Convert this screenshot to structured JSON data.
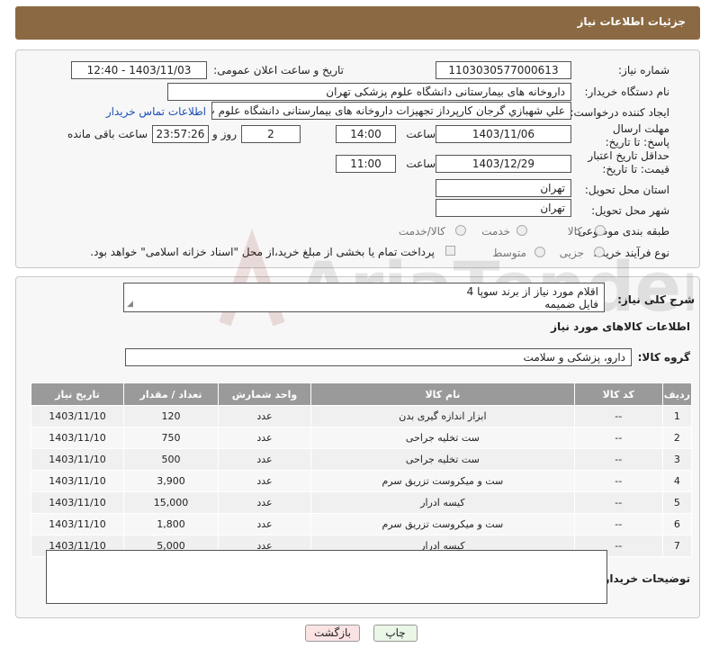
{
  "header": {
    "title": "جزئیات اطلاعات نیاز"
  },
  "form": {
    "need_number_label": "شماره نیاز:",
    "need_number": "1103030577000613",
    "announce_label": "تاریخ و ساعت اعلان عمومی:",
    "announce_value": "1403/11/03 - 12:40",
    "buyer_org_label": "نام دستگاه خریدار:",
    "buyer_org": "داروخانه های بیمارستانی دانشگاه علوم پزشکی تهران",
    "requester_label": "ایجاد کننده درخواست:",
    "requester": "علي شهبازي گرجان کارپرداز تجهیزات داروخانه های بیمارستانی دانشگاه علوم پ",
    "contact_link": "اطلاعات تماس خریدار",
    "reply_deadline_label": "مهلت ارسال پاسخ: تا تاریخ:",
    "reply_date": "1403/11/06",
    "time_label": "ساعت",
    "reply_time": "14:00",
    "days_value": "2",
    "days_label": "روز و",
    "remaining_value": "23:57:26",
    "remaining_label": "ساعت باقی مانده",
    "price_validity_label": "حداقل تاریخ اعتبار قیمت: تا تاریخ:",
    "validity_date": "1403/12/29",
    "validity_time": "11:00",
    "province_label": "استان محل تحویل:",
    "province": "تهران",
    "city_label": "شهر محل تحویل:",
    "city": "تهران",
    "category_label": "طبقه بندی موضوعی:",
    "category_options": [
      "کالا",
      "خدمت",
      "کالا/خدمت"
    ],
    "purchase_type_label": "نوع فرآیند خرید :",
    "purchase_options": [
      "جزیی",
      "متوسط"
    ],
    "payment_note": "پرداخت تمام یا بخشی از مبلغ خرید،از محل \"اسناد خزانه اسلامی\" خواهد بود."
  },
  "description": {
    "label": "شرح کلی نیاز:",
    "line1": "اقلام مورد نیاز از برند سوپا 4",
    "line2": "فایل ضمیمه"
  },
  "goods": {
    "section_title": "اطلاعات کالاهای مورد نیاز",
    "group_label": "گروه کالا:",
    "group_value": "دارو، پزشکی و سلامت"
  },
  "table": {
    "columns": [
      "ردیف",
      "کد کالا",
      "نام کالا",
      "واحد شمارش",
      "تعداد / مقدار",
      "تاریخ نیاز"
    ],
    "rows": [
      [
        "1",
        "--",
        "ابزار اندازه گیری بدن",
        "عدد",
        "120",
        "1403/11/10"
      ],
      [
        "2",
        "--",
        "ست تخلیه جراحی",
        "عدد",
        "750",
        "1403/11/10"
      ],
      [
        "3",
        "--",
        "ست تخلیه جراحی",
        "عدد",
        "500",
        "1403/11/10"
      ],
      [
        "4",
        "--",
        "ست و میکروست تزریق سرم",
        "عدد",
        "3,900",
        "1403/11/10"
      ],
      [
        "5",
        "--",
        "کیسه ادرار",
        "عدد",
        "15,000",
        "1403/11/10"
      ],
      [
        "6",
        "--",
        "ست و میکروست تزریق سرم",
        "عدد",
        "1,800",
        "1403/11/10"
      ],
      [
        "7",
        "--",
        "کیسه ادرار",
        "عدد",
        "5,000",
        "1403/11/10"
      ]
    ]
  },
  "buyer_notes": {
    "label": "توضیحات خریدار:",
    "value": ""
  },
  "buttons": {
    "print": "چاپ",
    "back": "بازگشت"
  },
  "watermark": {
    "text": "AriaTender.neT"
  }
}
